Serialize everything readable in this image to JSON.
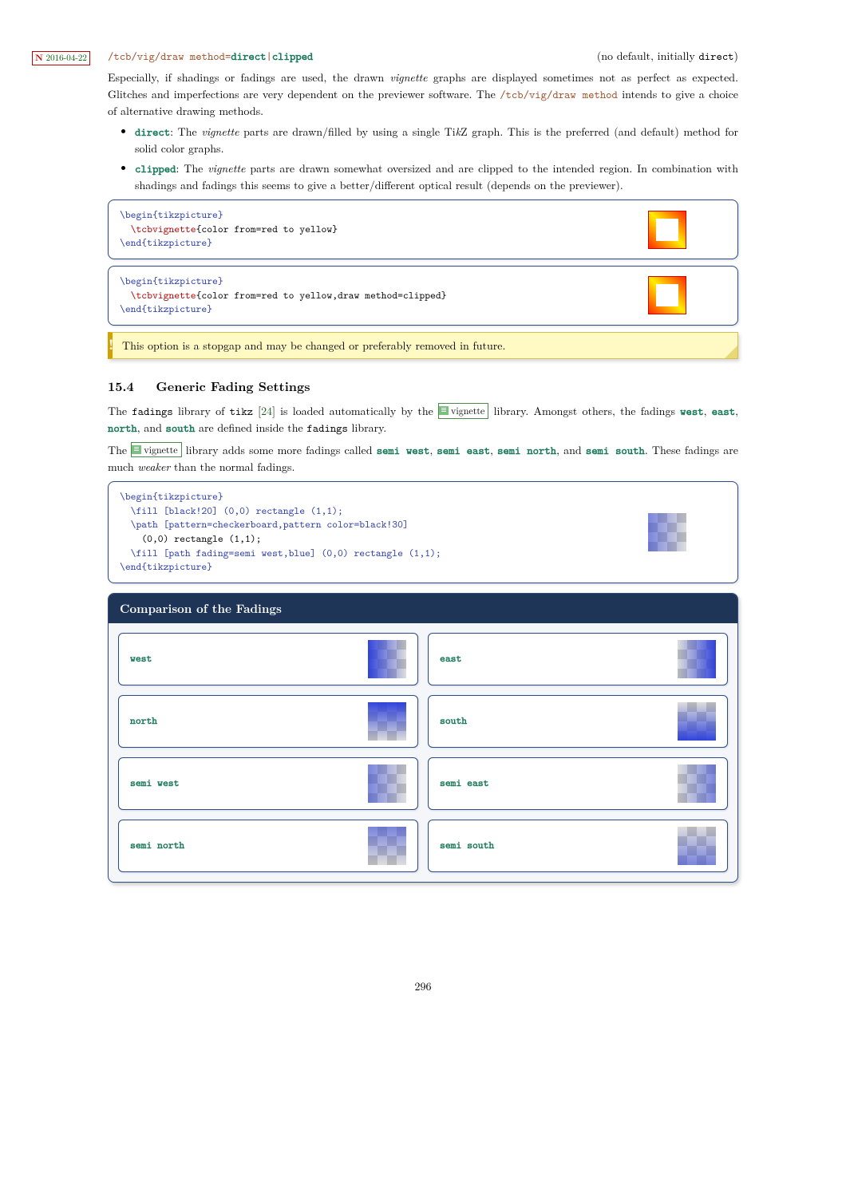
{
  "version": {
    "badge_prefix": "N",
    "date": "2016-04-22"
  },
  "option": {
    "path": "/tcb/vig/draw method",
    "equals": "=",
    "value_a": "direct",
    "value_sep": "|",
    "value_b": "clipped",
    "default_text": "(no default, initially ",
    "default_value": "direct",
    "default_close": ")"
  },
  "intro": "Especially, if shadings or fadings are used, the drawn vignette graphs are displayed sometimes not as perfect as expected. Glitches and imperfections are very dependent on the previewer software. The /tcb/vig/draw method intends to give a choice of alternative drawing methods.",
  "bullets": [
    {
      "key": "direct",
      "text": ": The vignette parts are drawn/filled by using a single TikZ graph. This is the preferred (and default) method for solid color graphs."
    },
    {
      "key": "clipped",
      "text": ": The vignette parts are drawn somewhat oversized and are clipped to the intended region. In combination with shadings and fadings this seems to give a better/different optical result (depends on the previewer)."
    }
  ],
  "code1": {
    "l1": "\\begin{tikzpicture}",
    "l2a": "  \\tcbvignette",
    "l2b": "{color from=red to yellow}",
    "l3": "\\end{tikzpicture}"
  },
  "code2": {
    "l1": "\\begin{tikzpicture}",
    "l2a": "  \\tcbvignette",
    "l2b": "{color from=red to yellow,draw method=clipped}",
    "l3": "\\end{tikzpicture}"
  },
  "warn": "This option is a stopgap and may be changed or preferably removed in future.",
  "section": {
    "num": "15.4",
    "title": "Generic Fading Settings"
  },
  "para1": {
    "a": "The ",
    "b": "fadings",
    "c": " library of ",
    "d": "tikz",
    "e": " [",
    "ref": "24",
    "f": "] is loaded automatically by the ",
    "lib": "vignette",
    "g": " library. Amongst others, the fadings ",
    "w": "west",
    "x": "east",
    "y": "north",
    "z": "south",
    "h": " are defined inside the ",
    "i": "fadings",
    "j": " library."
  },
  "para2": {
    "a": "The ",
    "lib": "vignette",
    "b": " library adds some more fadings called ",
    "sw": "semi west",
    "se": "semi east",
    "sn": "semi north",
    "ss": "semi south",
    "c": ". These fadings are much ",
    "weaker": "weaker",
    "d": " than the normal fadings."
  },
  "code3": {
    "l1": "\\begin{tikzpicture}",
    "l2": "  \\fill [black!20] (0,0) rectangle (1,1);",
    "l3": "  \\path [pattern=checkerboard,pattern color=black!30]",
    "l4": "    (0,0) rectangle (1,1);",
    "l5": "  \\fill [path fading=semi west,blue] (0,0) rectangle (1,1);",
    "l6": "\\end{tikzpicture}"
  },
  "comparison": {
    "title": "Comparison of the Fadings",
    "items": [
      {
        "name": "west",
        "cls": "fade-west"
      },
      {
        "name": "east",
        "cls": "fade-east"
      },
      {
        "name": "north",
        "cls": "fade-north"
      },
      {
        "name": "south",
        "cls": "fade-south"
      },
      {
        "name": "semi west",
        "cls": "fade-swest"
      },
      {
        "name": "semi east",
        "cls": "fade-seast"
      },
      {
        "name": "semi north",
        "cls": "fade-snorth"
      },
      {
        "name": "semi south",
        "cls": "fade-ssouth"
      }
    ]
  },
  "page": "296"
}
